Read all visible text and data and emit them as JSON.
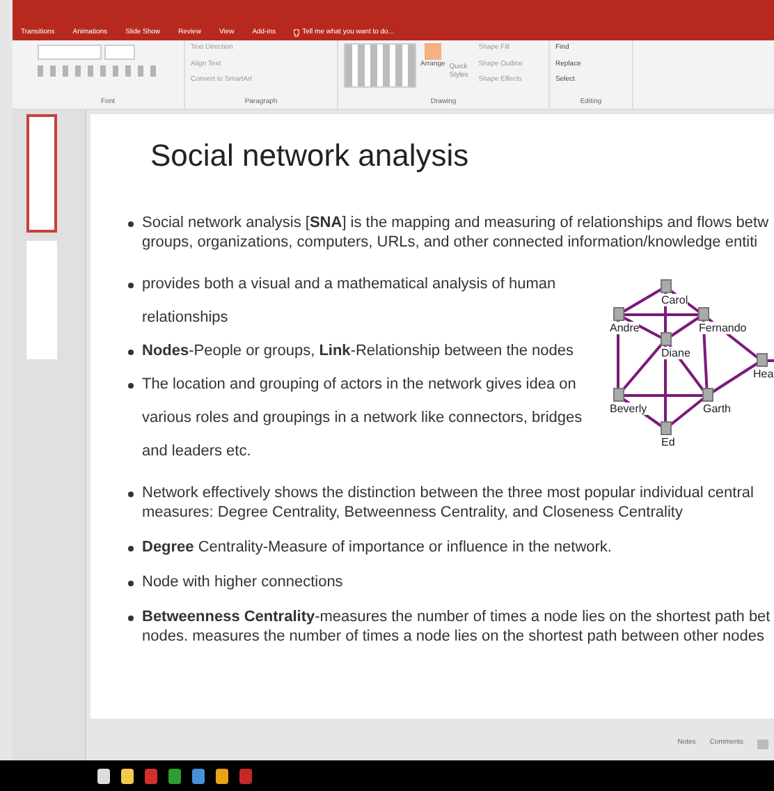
{
  "ribbon_tabs": [
    {
      "label": "Transitions"
    },
    {
      "label": "Animations"
    },
    {
      "label": "Slide Show"
    },
    {
      "label": "Review"
    },
    {
      "label": "View"
    },
    {
      "label": "Add-ins"
    }
  ],
  "tell_me": {
    "placeholder": "Tell me what you want to do..."
  },
  "ribbon_groups": [
    {
      "label": "Font"
    },
    {
      "label": "Paragraph",
      "items": [
        "Text Direction",
        "Align Text",
        "Convert to SmartArt"
      ]
    },
    {
      "label": "Drawing",
      "items": [
        "Arrange",
        "Quick Styles",
        "Shape Fill",
        "Shape Outline",
        "Shape Effects"
      ]
    },
    {
      "label": "Editing",
      "items": [
        "Find",
        "Replace",
        "Select"
      ]
    }
  ],
  "slide": {
    "title": "Social network analysis",
    "bullets_top": [
      {
        "lines": [
          "Social network analysis [**SNA**] is the mapping and measuring of relationships and flows betw",
          "groups, organizations, computers, URLs, and other connected information/knowledge entiti"
        ]
      }
    ],
    "bullets_mid": [
      {
        "lines": [
          "provides both a visual and a mathematical analysis of human",
          "relationships"
        ]
      },
      {
        "lines": [
          "**Nodes**-People or groups, **Link**-Relationship between the nodes"
        ]
      },
      {
        "lines": [
          "The location and grouping of actors in the network gives  idea on",
          "various roles and groupings in a network like connectors, bridges",
          "and leaders etc."
        ]
      }
    ],
    "network_nodes": [
      "Carol",
      "Andre",
      "Fernando",
      "Diane",
      "Hea",
      "Beverly",
      "Garth",
      "Ed"
    ],
    "bullets_bottom": [
      {
        "lines": [
          "Network effectively shows the distinction between the three most popular individual central",
          "measures: Degree Centrality, Betweenness Centrality, and Closeness Centrality"
        ]
      },
      {
        "lines": [
          "**Degree** Centrality-Measure of importance or influence in the network."
        ]
      },
      {
        "lines": [
          "Node with higher connections"
        ]
      },
      {
        "lines": [
          "**Betweenness Centrality**-measures the number of times a node lies on the shortest path bet",
          "nodes. measures the number of times a node lies on the shortest path between other nodes"
        ]
      }
    ]
  },
  "status_bar": {
    "buttons": [
      "Notes",
      "Comments"
    ]
  }
}
